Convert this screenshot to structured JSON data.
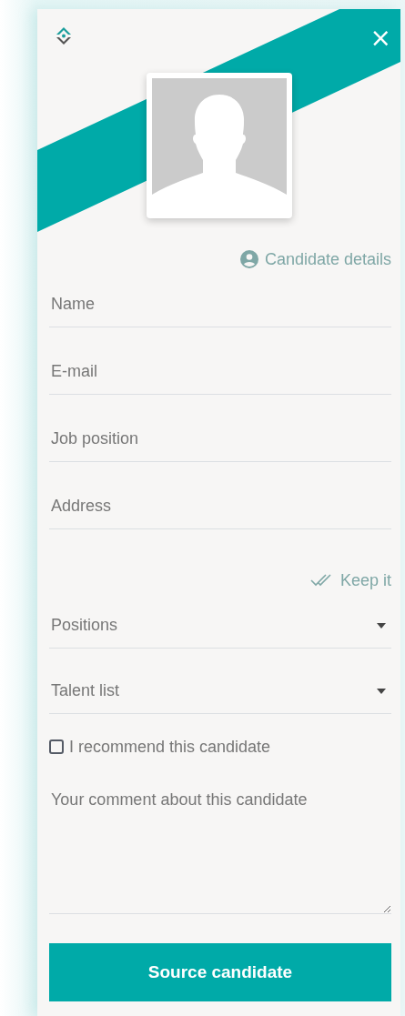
{
  "header": {
    "close": "×"
  },
  "candidate_details": {
    "label": "Candidate details"
  },
  "fields": [
    {
      "kind": "text",
      "placeholder": "Name"
    },
    {
      "kind": "text",
      "placeholder": "E-mail"
    },
    {
      "kind": "text",
      "placeholder": "Job position"
    },
    {
      "kind": "text",
      "placeholder": "Address"
    }
  ],
  "keep_it": {
    "label": "Keep it"
  },
  "dropdowns": [
    {
      "label": "Positions"
    },
    {
      "label": "Talent list"
    }
  ],
  "recommend": {
    "label": "I recommend this candidate",
    "checked": false
  },
  "comment": {
    "placeholder": "Your comment about this candidate"
  },
  "submit": {
    "label": "Source candidate"
  }
}
